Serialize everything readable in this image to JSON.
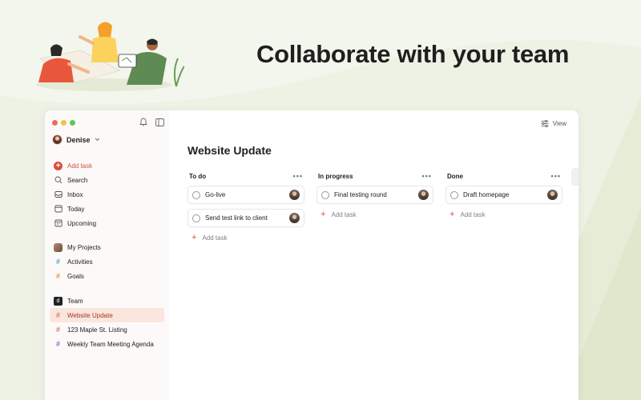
{
  "headline": "Collaborate with your team",
  "colors": {
    "accent": "#dc4c3e",
    "background": "#eef2e4",
    "active_bg": "#fbe6de"
  },
  "sidebar": {
    "user_name": "Denise",
    "add_task_label": "Add task",
    "nav": [
      {
        "label": "Search",
        "icon": "search-icon"
      },
      {
        "label": "Inbox",
        "icon": "inbox-icon"
      },
      {
        "label": "Today",
        "icon": "calendar-today-icon"
      },
      {
        "label": "Upcoming",
        "icon": "calendar-upcoming-icon"
      }
    ],
    "my_projects": {
      "title": "My Projects",
      "items": [
        {
          "label": "Activities",
          "color": "#4aa6d8"
        },
        {
          "label": "Goals",
          "color": "#e59048"
        }
      ]
    },
    "team": {
      "title": "Team",
      "items": [
        {
          "label": "Website Update",
          "color": "#e07070",
          "active": true
        },
        {
          "label": "123 Maple St. Listing",
          "color": "#e07070"
        },
        {
          "label": "Weekly Team Meeting Agenda",
          "color": "#9a5fd1"
        }
      ]
    }
  },
  "main": {
    "view_label": "View",
    "title": "Website Update",
    "add_task_label": "Add task",
    "columns": [
      {
        "title": "To do",
        "tasks": [
          "Go-live",
          "Send test link to client"
        ]
      },
      {
        "title": "In progress",
        "tasks": [
          "Final testing round"
        ]
      },
      {
        "title": "Done",
        "tasks": [
          "Draft homepage"
        ]
      }
    ]
  }
}
